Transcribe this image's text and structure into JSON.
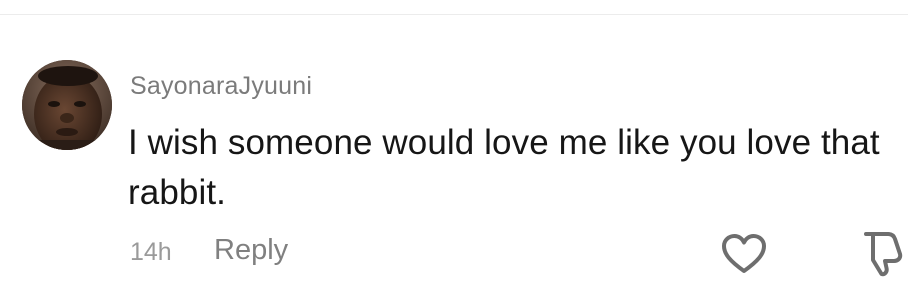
{
  "comment": {
    "username": "SayonaraJyuuni",
    "text": "I wish someone would love me like you love that rabbit.",
    "timestamp": "14h",
    "reply_label": "Reply",
    "avatar_icon": "user-avatar-photo",
    "like_icon": "heart-outline-icon",
    "dislike_icon": "thumbs-down-outline-icon"
  },
  "colors": {
    "username": "#7b7b7b",
    "text": "#161616",
    "timestamp": "#9a9a9a",
    "reply": "#808080",
    "icon_stroke": "#6e6e6e",
    "divider": "#ececec"
  }
}
